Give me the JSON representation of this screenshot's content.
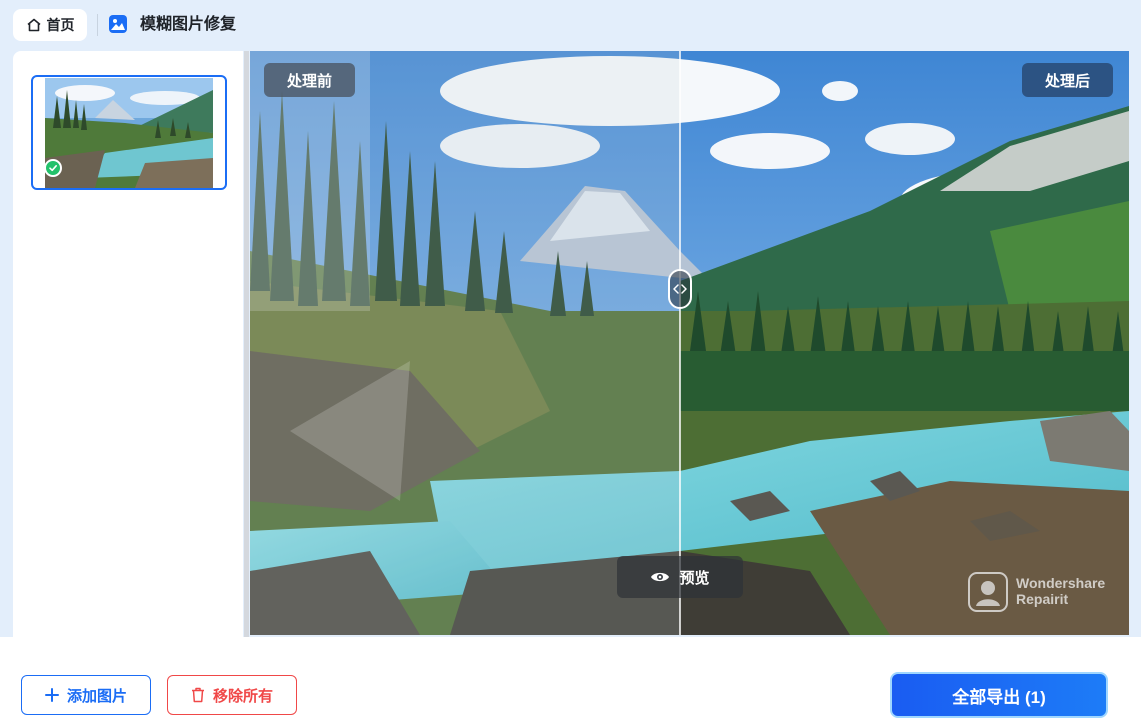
{
  "header": {
    "home_label": "首页",
    "app_title": "模糊图片修复"
  },
  "preview": {
    "before_label": "处理前",
    "after_label": "处理后",
    "preview_button": "预览",
    "watermark_line1": "Wondershare",
    "watermark_line2": "Repairit"
  },
  "footer": {
    "add_label": "添加图片",
    "remove_label": "移除所有",
    "export_label": "全部导出 (1)"
  },
  "colors": {
    "accent": "#1b6df5",
    "danger": "#f04848",
    "success": "#23c16b",
    "background": "#e3eefb"
  },
  "icons": [
    "home-icon",
    "image-icon",
    "check-icon",
    "eye-icon",
    "plus-icon",
    "trash-icon",
    "split-arrows-icon"
  ]
}
